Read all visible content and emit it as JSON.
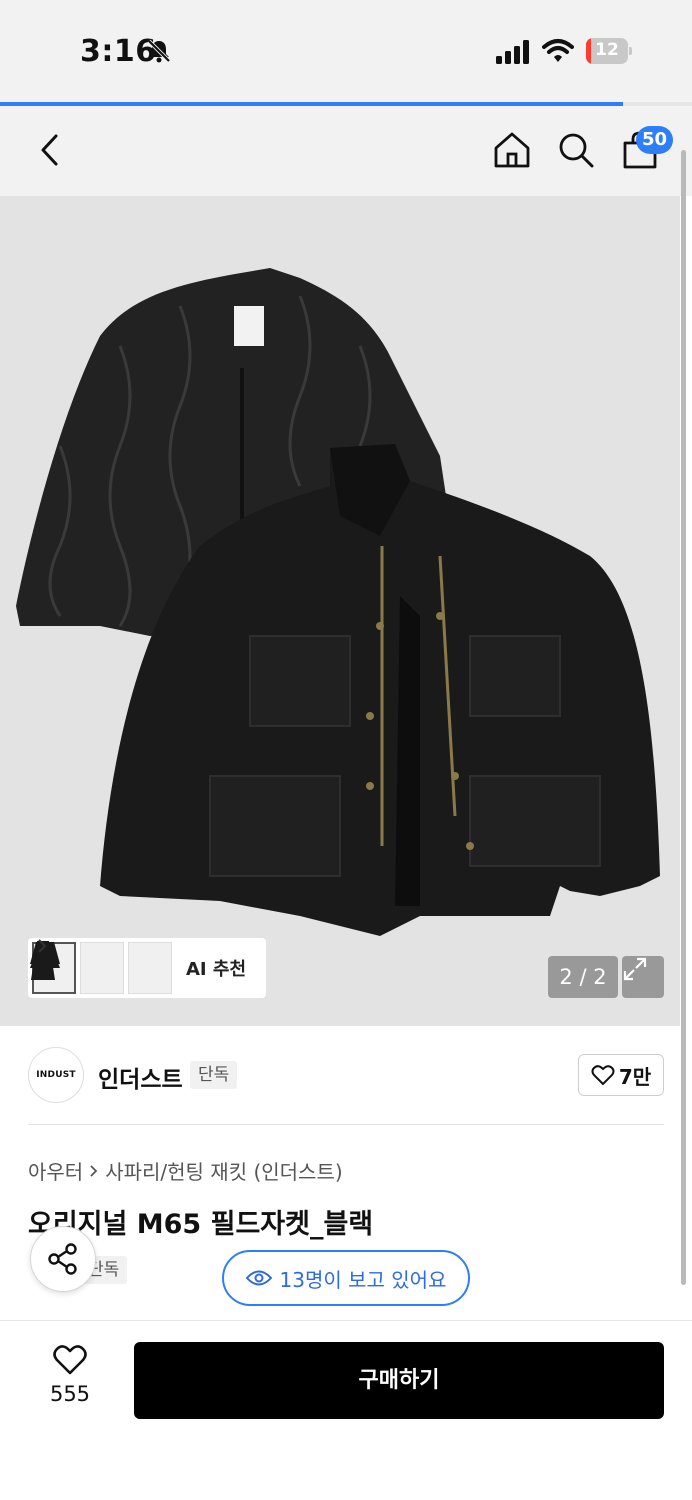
{
  "status_bar": {
    "time": "3:16",
    "battery_level": "12",
    "battery_color": "#ff3b30",
    "icons": [
      "bell-slash-icon",
      "cellular-signal-icon",
      "wifi-icon",
      "battery-icon"
    ]
  },
  "page_load_progress_percent": 90,
  "nav": {
    "icons": [
      "back-chevron-icon",
      "home-icon",
      "search-icon",
      "shopping-bag-icon"
    ],
    "cart_count": "50",
    "accent_color": "#2d7ff9"
  },
  "gallery": {
    "ai_label": "AI 추천",
    "page_indicator": "2 / 2",
    "icons": [
      "expand-icon",
      "chevron-right-icon"
    ]
  },
  "brand": {
    "logo_text": "INDUST",
    "name": "인더스트",
    "exclusive_tag": "단독",
    "like_count": "7만"
  },
  "product": {
    "breadcrumb": [
      "아우터",
      "사파리/헌팅 재킷 (인더스트)"
    ],
    "title": "오리지널 M65 필드자켓_블랙",
    "exclusive_tag": "단독",
    "viewers_text": "13명이 보고 있어요"
  },
  "bottom": {
    "wish_count": "555",
    "buy_label": "구매하기"
  }
}
